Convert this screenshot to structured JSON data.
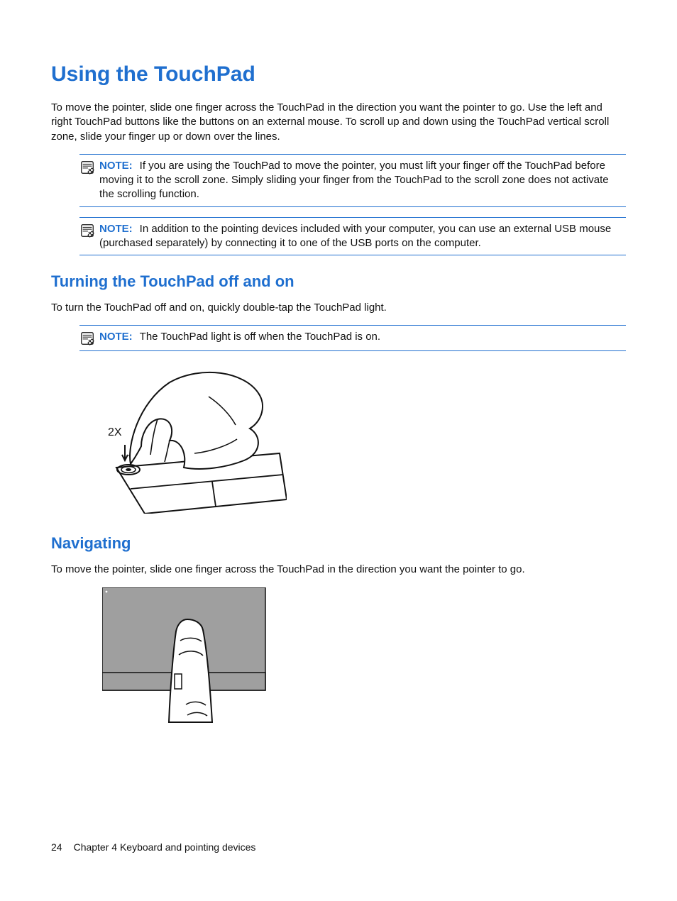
{
  "title": "Using the TouchPad",
  "intro": "To move the pointer, slide one finger across the TouchPad in the direction you want the pointer to go. Use the left and right TouchPad buttons like the buttons on an external mouse. To scroll up and down using the TouchPad vertical scroll zone, slide your finger up or down over the lines.",
  "notes": [
    {
      "label": "NOTE:",
      "text": "If you are using the TouchPad to move the pointer, you must lift your finger off the TouchPad before moving it to the scroll zone. Simply sliding your finger from the TouchPad to the scroll zone does not activate the scrolling function."
    },
    {
      "label": "NOTE:",
      "text": "In addition to the pointing devices included with your computer, you can use an external USB mouse (purchased separately) by connecting it to one of the USB ports on the computer."
    }
  ],
  "sections": [
    {
      "heading": "Turning the TouchPad off and on",
      "body": "To turn the TouchPad off and on, quickly double-tap the TouchPad light.",
      "note": {
        "label": "NOTE:",
        "text": "The TouchPad light is off when the TouchPad is on."
      },
      "illus_label": "2X"
    },
    {
      "heading": "Navigating",
      "body": "To move the pointer, slide one finger across the TouchPad in the direction you want the pointer to go."
    }
  ],
  "footer": {
    "page": "24",
    "chapter": "Chapter 4   Keyboard and pointing devices"
  }
}
